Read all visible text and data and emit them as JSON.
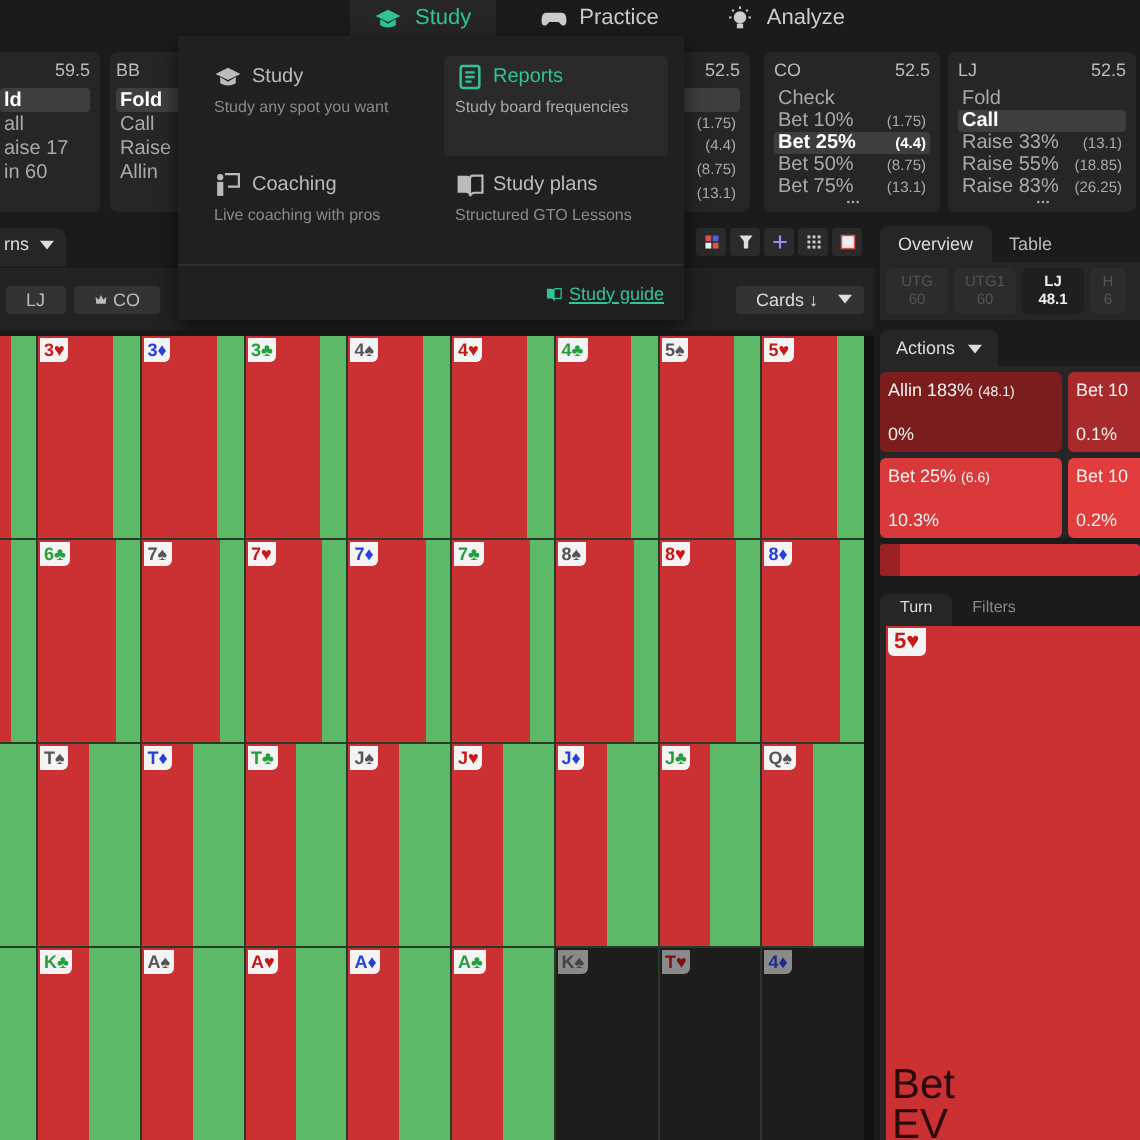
{
  "nav": [
    {
      "label": "Study",
      "selected": true
    },
    {
      "label": "Practice",
      "selected": false
    },
    {
      "label": "Analyze",
      "selected": false
    }
  ],
  "seats": [
    {
      "stack": "59.5",
      "actions": [
        {
          "label": "ld",
          "selected": true
        },
        {
          "label": "all",
          "selected": false
        },
        {
          "label": "aise 17",
          "selected": false
        },
        {
          "label": "in 60",
          "selected": false
        }
      ],
      "more": false
    },
    {
      "position": "BB",
      "actions": [
        {
          "label": "Fold",
          "selected": true
        },
        {
          "label": "Call",
          "selected": false
        },
        {
          "label": "Raise",
          "selected": false
        },
        {
          "label": "Allin",
          "selected": false
        }
      ],
      "more": false
    },
    {
      "stack": "52.5",
      "actions": [
        {
          "selected": true
        },
        {
          "amount": "(1.75)",
          "selected": false
        },
        {
          "amount": "(4.4)",
          "selected": false
        },
        {
          "amount": "(8.75)",
          "selected": false
        },
        {
          "amount": "(13.1)",
          "selected": false
        }
      ],
      "more": false
    },
    {
      "position": "CO",
      "stack": "52.5",
      "actions": [
        {
          "label": "Check",
          "selected": false
        },
        {
          "label": "Bet 10%",
          "amount": "(1.75)",
          "selected": false
        },
        {
          "label": "Bet 25%",
          "amount": "(4.4)",
          "selected": true
        },
        {
          "label": "Bet 50%",
          "amount": "(8.75)",
          "selected": false
        },
        {
          "label": "Bet 75%",
          "amount": "(13.1)",
          "selected": false
        }
      ],
      "more": true
    },
    {
      "position": "LJ",
      "stack": "52.5",
      "actions": [
        {
          "label": "Fold",
          "selected": false
        },
        {
          "label": "Call",
          "selected": true
        },
        {
          "label": "Raise 33%",
          "amount": "(13.1)",
          "selected": false
        },
        {
          "label": "Raise 55%",
          "amount": "(18.85)",
          "selected": false
        },
        {
          "label": "Raise 83%",
          "amount": "(26.25)",
          "selected": false
        }
      ],
      "more": true
    }
  ],
  "menu": {
    "items": [
      {
        "title": "Study",
        "subtitle": "Study any spot you want",
        "selected": false
      },
      {
        "title": "Reports",
        "subtitle": "Study board frequencies",
        "selected": true
      },
      {
        "title": "Coaching",
        "subtitle": "Live coaching with pros",
        "selected": false
      },
      {
        "title": "Study plans",
        "subtitle": "Structured GTO Lessons",
        "selected": false
      }
    ],
    "link": "Study guide"
  },
  "view_tab": "rns",
  "filters": [
    {
      "label": "LJ"
    },
    {
      "label": "CO"
    }
  ],
  "sort": "Cards ↓",
  "grid": [
    {
      "cells": [
        {
          "card": "3♥",
          "color": "#c81818",
          "disabled": false
        },
        {
          "card": "3♦",
          "color": "#2740d8",
          "disabled": false
        },
        {
          "card": "3♣",
          "color": "#23a03c",
          "disabled": false
        },
        {
          "card": "4♠",
          "color": "#555555",
          "disabled": false
        },
        {
          "card": "4♥",
          "color": "#c81818",
          "disabled": false
        },
        {
          "card": "4♣",
          "color": "#23a03c",
          "disabled": false
        },
        {
          "card": "5♠",
          "color": "#555555",
          "disabled": false
        },
        {
          "card": "5♥",
          "color": "#c81818",
          "disabled": false
        }
      ]
    },
    {
      "cells": [
        {
          "card": "6♣",
          "color": "#23a03c",
          "disabled": false
        },
        {
          "card": "7♠",
          "color": "#555555",
          "disabled": false
        },
        {
          "card": "7♥",
          "color": "#c81818",
          "disabled": false
        },
        {
          "card": "7♦",
          "color": "#2740d8",
          "disabled": false
        },
        {
          "card": "7♣",
          "color": "#23a03c",
          "disabled": false
        },
        {
          "card": "8♠",
          "color": "#555555",
          "disabled": false
        },
        {
          "card": "8♥",
          "color": "#c81818",
          "disabled": false
        },
        {
          "card": "8♦",
          "color": "#2740d8",
          "disabled": false
        }
      ]
    },
    {
      "cells": [
        {
          "card": "T♠",
          "color": "#555555",
          "disabled": false
        },
        {
          "card": "T♦",
          "color": "#2740d8",
          "disabled": false
        },
        {
          "card": "T♣",
          "color": "#23a03c",
          "disabled": false
        },
        {
          "card": "J♠",
          "color": "#555555",
          "disabled": false
        },
        {
          "card": "J♥",
          "color": "#c81818",
          "disabled": false
        },
        {
          "card": "J♦",
          "color": "#2740d8",
          "disabled": false
        },
        {
          "card": "J♣",
          "color": "#23a03c",
          "disabled": false
        },
        {
          "card": "Q♠",
          "color": "#555555",
          "disabled": false
        }
      ]
    },
    {
      "cells": [
        {
          "card": "K♣",
          "color": "#23a03c",
          "disabled": false
        },
        {
          "card": "A♠",
          "color": "#555555",
          "disabled": false
        },
        {
          "card": "A♥",
          "color": "#c81818",
          "disabled": false
        },
        {
          "card": "A♦",
          "color": "#2740d8",
          "disabled": false
        },
        {
          "card": "A♣",
          "color": "#23a03c",
          "disabled": false
        },
        {
          "card": "K♠",
          "disabled": true
        },
        {
          "card": "T♥",
          "disabled": true
        },
        {
          "card": "4♦",
          "disabled": true
        }
      ]
    }
  ],
  "panel_tabs": [
    {
      "label": "Overview",
      "selected": true
    },
    {
      "label": "Table",
      "selected": false
    }
  ],
  "positions": [
    {
      "name": "UTG",
      "stack": "60",
      "selected": false
    },
    {
      "name": "UTG1",
      "stack": "60",
      "selected": false
    },
    {
      "name": "LJ",
      "stack": "48.1",
      "selected": true
    },
    {
      "name": "H",
      "stack": "6",
      "selected": false
    }
  ],
  "actions_label": "Actions",
  "tiles": [
    {
      "label": "Allin 183%",
      "amount": "(48.1)",
      "freq": "0%",
      "color": "#7b1d1d"
    },
    {
      "label": "Bet 10",
      "freq": "0.1%",
      "color": "#a92a2a"
    },
    {
      "label": "Bet 25%",
      "amount": "(6.6)",
      "freq": "10.3%",
      "color": "#d9393a"
    },
    {
      "label": "Bet 10",
      "freq": "0.2%",
      "color": "#e23c3c"
    }
  ],
  "strategy_bar": {
    "level": 0.08
  },
  "detail_tabs": [
    {
      "label": "Turn",
      "selected": true
    },
    {
      "label": "Filters",
      "selected": false
    }
  ],
  "turn_card": {
    "card": "5♥",
    "color": "#c81818"
  },
  "ev_label": "Bet EV"
}
